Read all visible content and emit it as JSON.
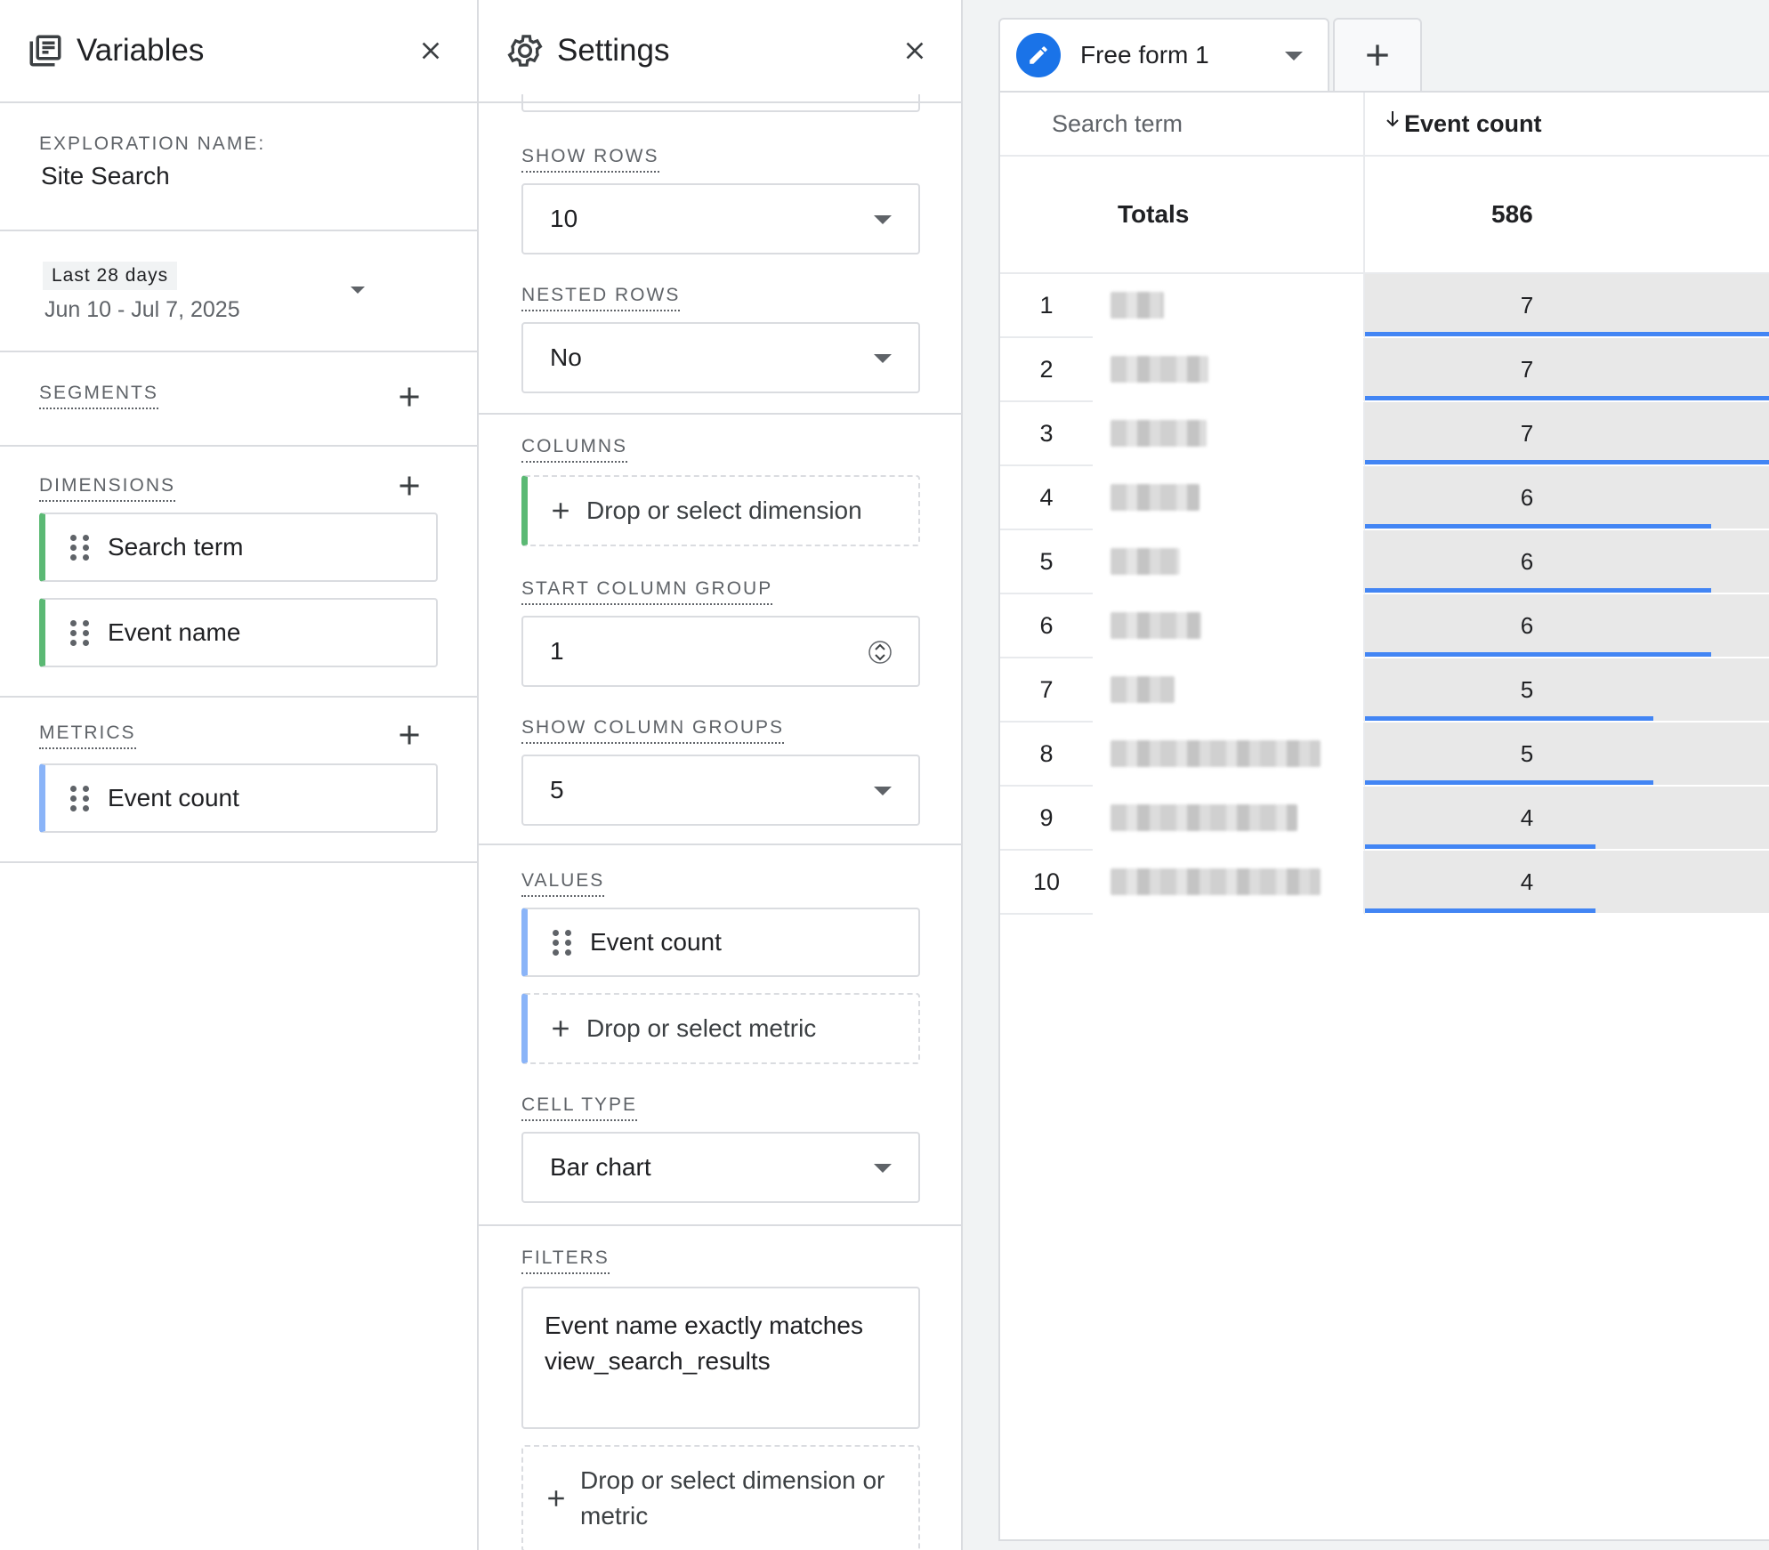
{
  "variables": {
    "title": "Variables",
    "exploration_label": "EXPLORATION NAME:",
    "exploration_name": "Site Search",
    "date_badge": "Last 28 days",
    "date_range": "Jun 10 - Jul 7, 2025",
    "segments_label": "SEGMENTS",
    "dimensions_label": "DIMENSIONS",
    "dimensions": [
      "Search term",
      "Event name"
    ],
    "metrics_label": "METRICS",
    "metrics": [
      "Event count"
    ]
  },
  "settings": {
    "title": "Settings",
    "show_rows_label": "SHOW ROWS",
    "show_rows_value": "10",
    "nested_rows_label": "NESTED ROWS",
    "nested_rows_value": "No",
    "columns_label": "COLUMNS",
    "columns_drop": "Drop or select dimension",
    "start_column_group_label": "START COLUMN GROUP",
    "start_column_group_value": "1",
    "show_column_groups_label": "SHOW COLUMN GROUPS",
    "show_column_groups_value": "5",
    "values_label": "VALUES",
    "values_item": "Event count",
    "values_drop": "Drop or select metric",
    "cell_type_label": "CELL TYPE",
    "cell_type_value": "Bar chart",
    "filters_label": "FILTERS",
    "filter_text": "Event name exactly matches view_search_results",
    "filters_drop": "Drop or select dimension or metric"
  },
  "canvas": {
    "tab_name": "Free form 1",
    "col_dimension": "Search term",
    "col_metric": "Event count",
    "totals_label": "Totals",
    "totals_value": "586",
    "rows": [
      {
        "n": "1",
        "v": "7",
        "blur": 60
      },
      {
        "n": "2",
        "v": "7",
        "blur": 110
      },
      {
        "n": "3",
        "v": "7",
        "blur": 108
      },
      {
        "n": "4",
        "v": "6",
        "blur": 100
      },
      {
        "n": "5",
        "v": "6",
        "blur": 78
      },
      {
        "n": "6",
        "v": "6",
        "blur": 102
      },
      {
        "n": "7",
        "v": "5",
        "blur": 72
      },
      {
        "n": "8",
        "v": "5",
        "blur": 236
      },
      {
        "n": "9",
        "v": "4",
        "blur": 210
      },
      {
        "n": "10",
        "v": "4",
        "blur": 236
      }
    ]
  },
  "colors": {
    "accent": "#1a73e8",
    "bar": "#4285f4",
    "dim": "#5bb974",
    "metric": "#8ab4f8"
  }
}
